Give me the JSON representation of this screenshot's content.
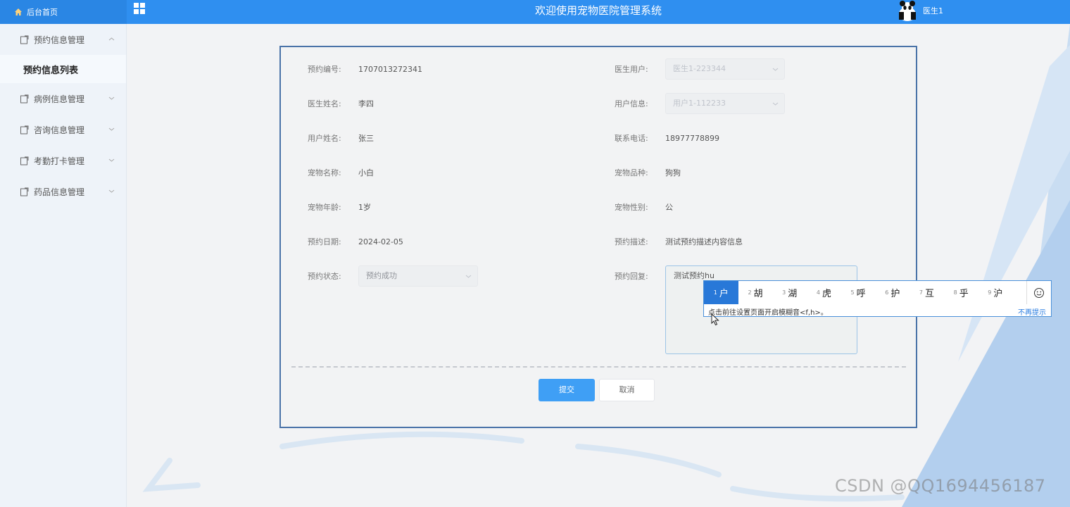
{
  "header": {
    "home_label": "后台首页",
    "title": "欢迎使用宠物医院管理系统",
    "user_name": "医生1"
  },
  "sidebar": {
    "items": [
      {
        "label": "预约信息管理",
        "expanded": true,
        "children": [
          {
            "label": "预约信息列表"
          }
        ]
      },
      {
        "label": "病例信息管理"
      },
      {
        "label": "咨询信息管理"
      },
      {
        "label": "考勤打卡管理"
      },
      {
        "label": "药品信息管理"
      }
    ]
  },
  "form": {
    "appointment_no": {
      "label": "预约编号:",
      "value": "1707013272341"
    },
    "doctor_user": {
      "label": "医生用户:",
      "value": "医生1-223344"
    },
    "doctor_name": {
      "label": "医生姓名:",
      "value": "李四"
    },
    "user_info": {
      "label": "用户信息:",
      "value": "用户1-112233"
    },
    "user_name": {
      "label": "用户姓名:",
      "value": "张三"
    },
    "phone": {
      "label": "联系电话:",
      "value": "18977778899"
    },
    "pet_name": {
      "label": "宠物名称:",
      "value": "小白"
    },
    "pet_breed": {
      "label": "宠物品种:",
      "value": "狗狗"
    },
    "pet_age": {
      "label": "宠物年龄:",
      "value": "1岁"
    },
    "pet_gender": {
      "label": "宠物性别:",
      "value": "公"
    },
    "appointment_date": {
      "label": "预约日期:",
      "value": "2024-02-05"
    },
    "appointment_desc": {
      "label": "预约描述:",
      "value": "测试预约描述内容信息"
    },
    "appointment_status": {
      "label": "预约状态:",
      "value": "预约成功"
    },
    "appointment_reply": {
      "label": "预约回复:",
      "value": "测试预约hu"
    },
    "submit_label": "提交",
    "cancel_label": "取消"
  },
  "ime": {
    "candidates": [
      {
        "num": "1",
        "char": "户"
      },
      {
        "num": "2",
        "char": "胡"
      },
      {
        "num": "3",
        "char": "湖"
      },
      {
        "num": "4",
        "char": "虎"
      },
      {
        "num": "5",
        "char": "呼"
      },
      {
        "num": "6",
        "char": "护"
      },
      {
        "num": "7",
        "char": "互"
      },
      {
        "num": "8",
        "char": "乎"
      },
      {
        "num": "9",
        "char": "沪"
      }
    ],
    "hint": "点击前往设置页面开启模糊音<f,h>。",
    "dismiss_label": "不再提示"
  },
  "watermark": "CSDN @QQ1694456187",
  "colors": {
    "header_bg": "#2f8ff0",
    "primary_button": "#3f9ff5",
    "ime_active": "#2878d8"
  }
}
